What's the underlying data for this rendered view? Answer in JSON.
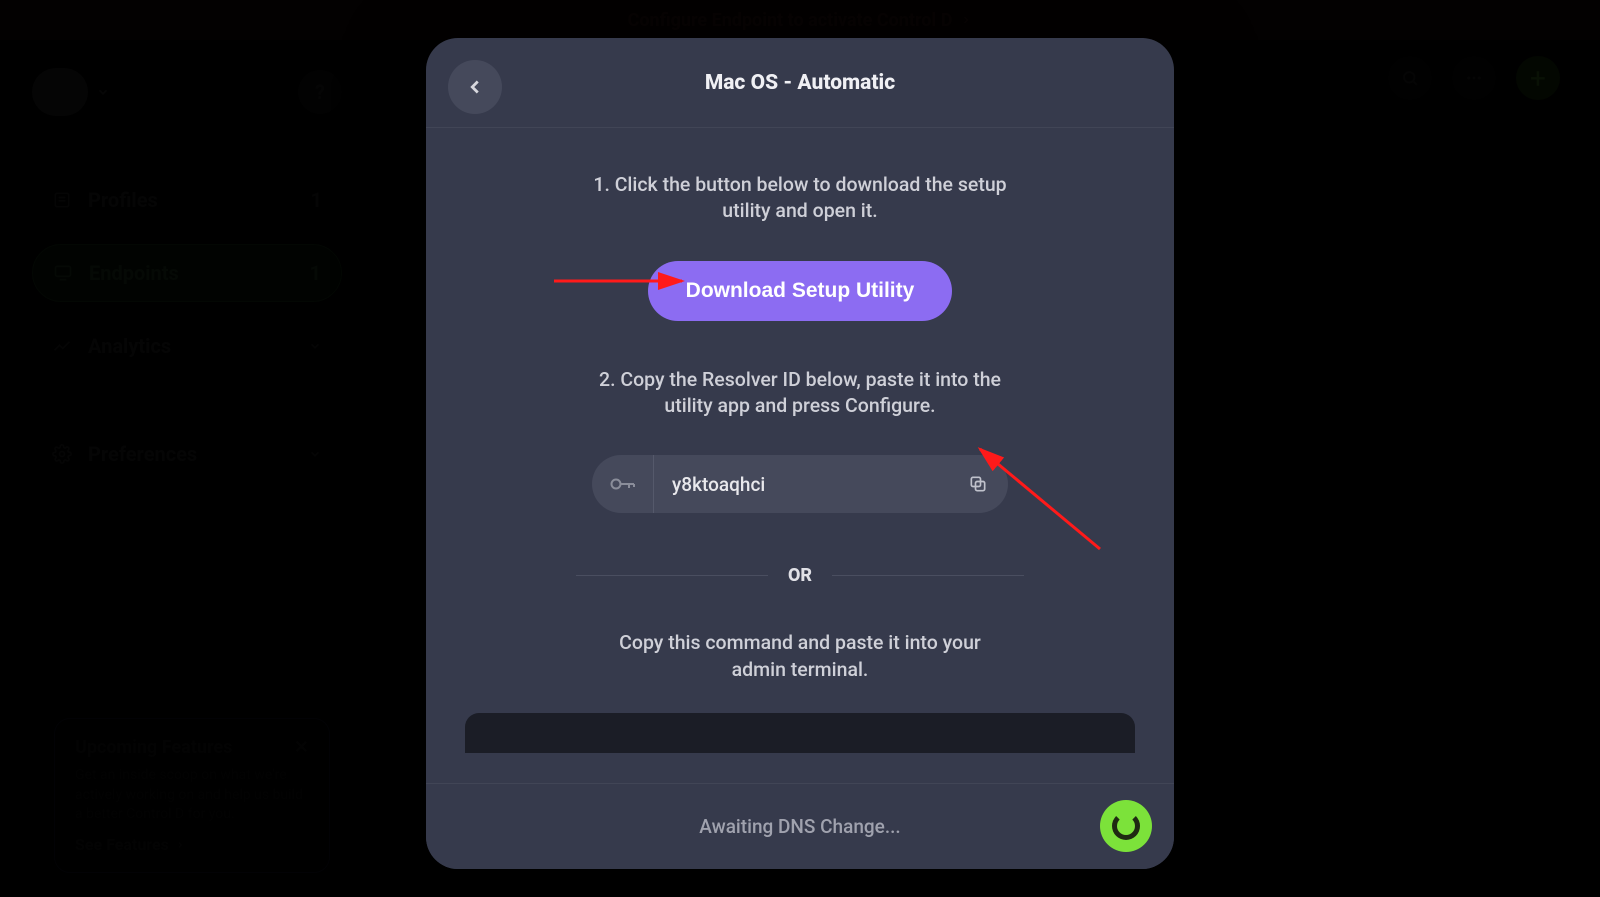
{
  "banner": {
    "text": "Configure Endpoint to activate Control D"
  },
  "sidebar": {
    "items": [
      {
        "label": "Profiles",
        "count": "1"
      },
      {
        "label": "Endpoints",
        "count": "1"
      },
      {
        "label": "Analytics"
      },
      {
        "label": "Preferences"
      }
    ]
  },
  "features": {
    "title": "Upcoming Features",
    "desc": "Get an inside scoop on what we're actively working on and help us build a better Control D for you.",
    "link": "See Features"
  },
  "modal": {
    "title": "Mac OS - Automatic",
    "step1": "1. Click the button below to download the setup utility and open it.",
    "download_label": "Download Setup Utility",
    "step2": "2. Copy the Resolver ID below, paste it into the utility app and press Configure.",
    "resolver_id": "y8ktoaqhci",
    "or": "OR",
    "step3": "Copy this command and paste it into your admin terminal.",
    "footer": "Awaiting DNS Change..."
  }
}
